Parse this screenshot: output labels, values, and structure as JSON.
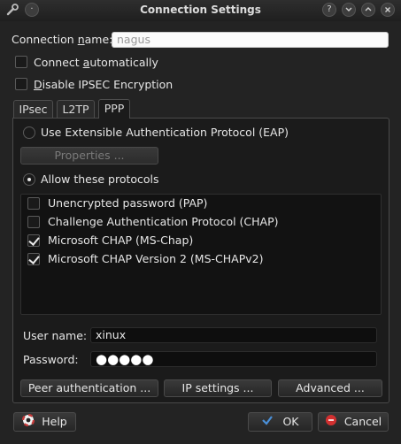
{
  "window": {
    "title": "Connection Settings",
    "buttons": [
      "?",
      "⌄",
      "⌃",
      "×"
    ]
  },
  "connection_name": {
    "label_pre": "Connection ",
    "label_ul": "n",
    "label_post": "ame:",
    "value": "nagus"
  },
  "connect_auto": {
    "label_pre": "Connect ",
    "label_ul": "a",
    "label_post": "utomatically",
    "checked": false
  },
  "disable_ipsec": {
    "label_ul": "D",
    "label_post": "isable IPSEC Encryption",
    "checked": false
  },
  "tabs": [
    {
      "label": "IPsec",
      "active": false
    },
    {
      "label": "L2TP",
      "active": false
    },
    {
      "label": "PPP",
      "active": true
    }
  ],
  "ppp": {
    "eap_label": "Use Extensible Authentication Protocol (EAP)",
    "properties_button": "Properties ...",
    "allow_label": "Allow these protocols",
    "protocols": [
      {
        "label": "Unencrypted password (PAP)",
        "checked": false
      },
      {
        "label": "Challenge Authentication Protocol (CHAP)",
        "checked": false
      },
      {
        "label": "Microsoft CHAP (MS-Chap)",
        "checked": true
      },
      {
        "label": "Microsoft CHAP Version 2 (MS-CHAPv2)",
        "checked": true
      }
    ],
    "user_name_label": "User name:",
    "user_name_value": "xinux",
    "password_label": "Password:",
    "password_value": "●●●●●",
    "peer_auth_button": "Peer authentication ...",
    "ip_settings_button": "IP settings ...",
    "advanced_button": "Advanced ..."
  },
  "footer": {
    "help": "Help",
    "ok": "OK",
    "cancel": "Cancel"
  },
  "colors": {
    "bg": "#232323",
    "panel": "#1b1b1b",
    "ok_icon": "#4a90d9",
    "cancel_icon": "#d23030",
    "help_icon": "#c43a3a"
  }
}
